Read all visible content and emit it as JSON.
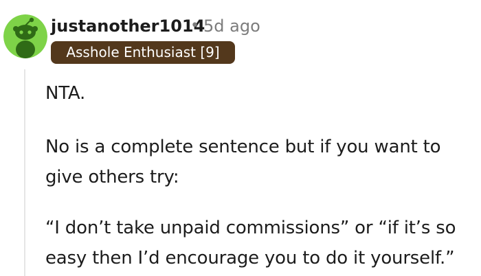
{
  "comment": {
    "avatar_icon": "reddit-snoo-avatar-icon",
    "avatar_color": "#7ed348",
    "username": "justanother1014",
    "separator": "•",
    "timestamp": "5d ago",
    "flair": "Asshole Enthusiast [9]",
    "flair_color": "#53381c",
    "body": {
      "p1": "NTA.",
      "p2": "No is a complete sentence but if you want to give others try:",
      "p3": "“I don’t take unpaid commissions” or “if it’s so easy then I’d encourage you to do it yourself.”"
    }
  }
}
